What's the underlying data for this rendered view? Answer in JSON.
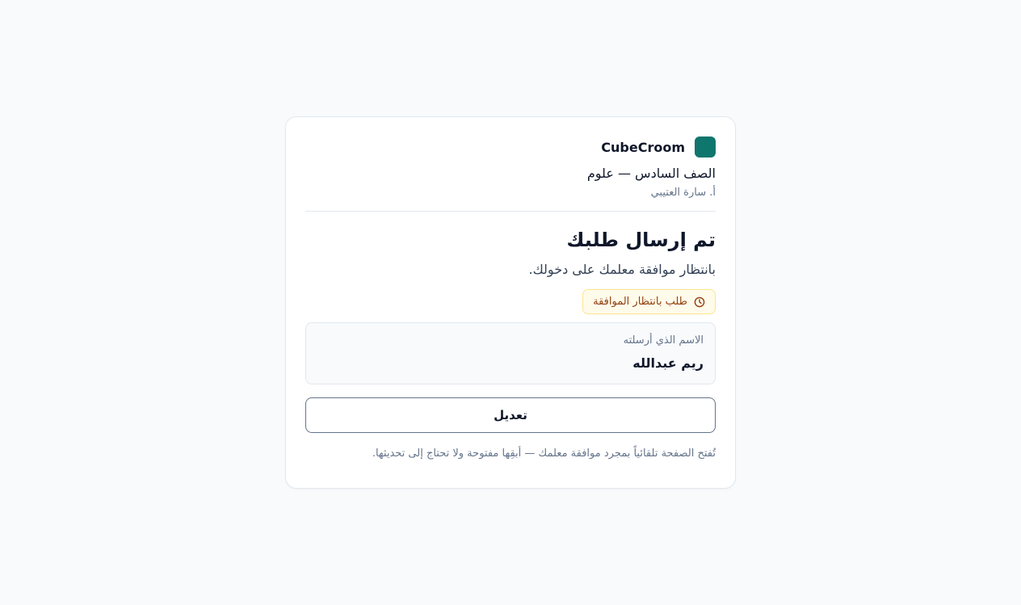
{
  "brand": {
    "name": "CubeCroom",
    "logo_color": "#0f766e"
  },
  "class_info": {
    "title": "الصف السادس — علوم",
    "teacher": "أ. سارة العتيبي"
  },
  "status": {
    "heading": "تم إرسال طلبك",
    "message": "بانتظار موافقة معلمك على دخولك.",
    "badge_label": "طلب بانتظار الموافقة",
    "badge_icon": "clock-icon"
  },
  "submission": {
    "label": "الاسم الذي أرسلته",
    "value": "ريم عبدالله"
  },
  "actions": {
    "edit_label": "تعديل"
  },
  "footnote": "تُفتح الصفحة تلقائياً بمجرد موافقة معلمك — أبقِها مفتوحة ولا تحتاج إلى تحديثها."
}
